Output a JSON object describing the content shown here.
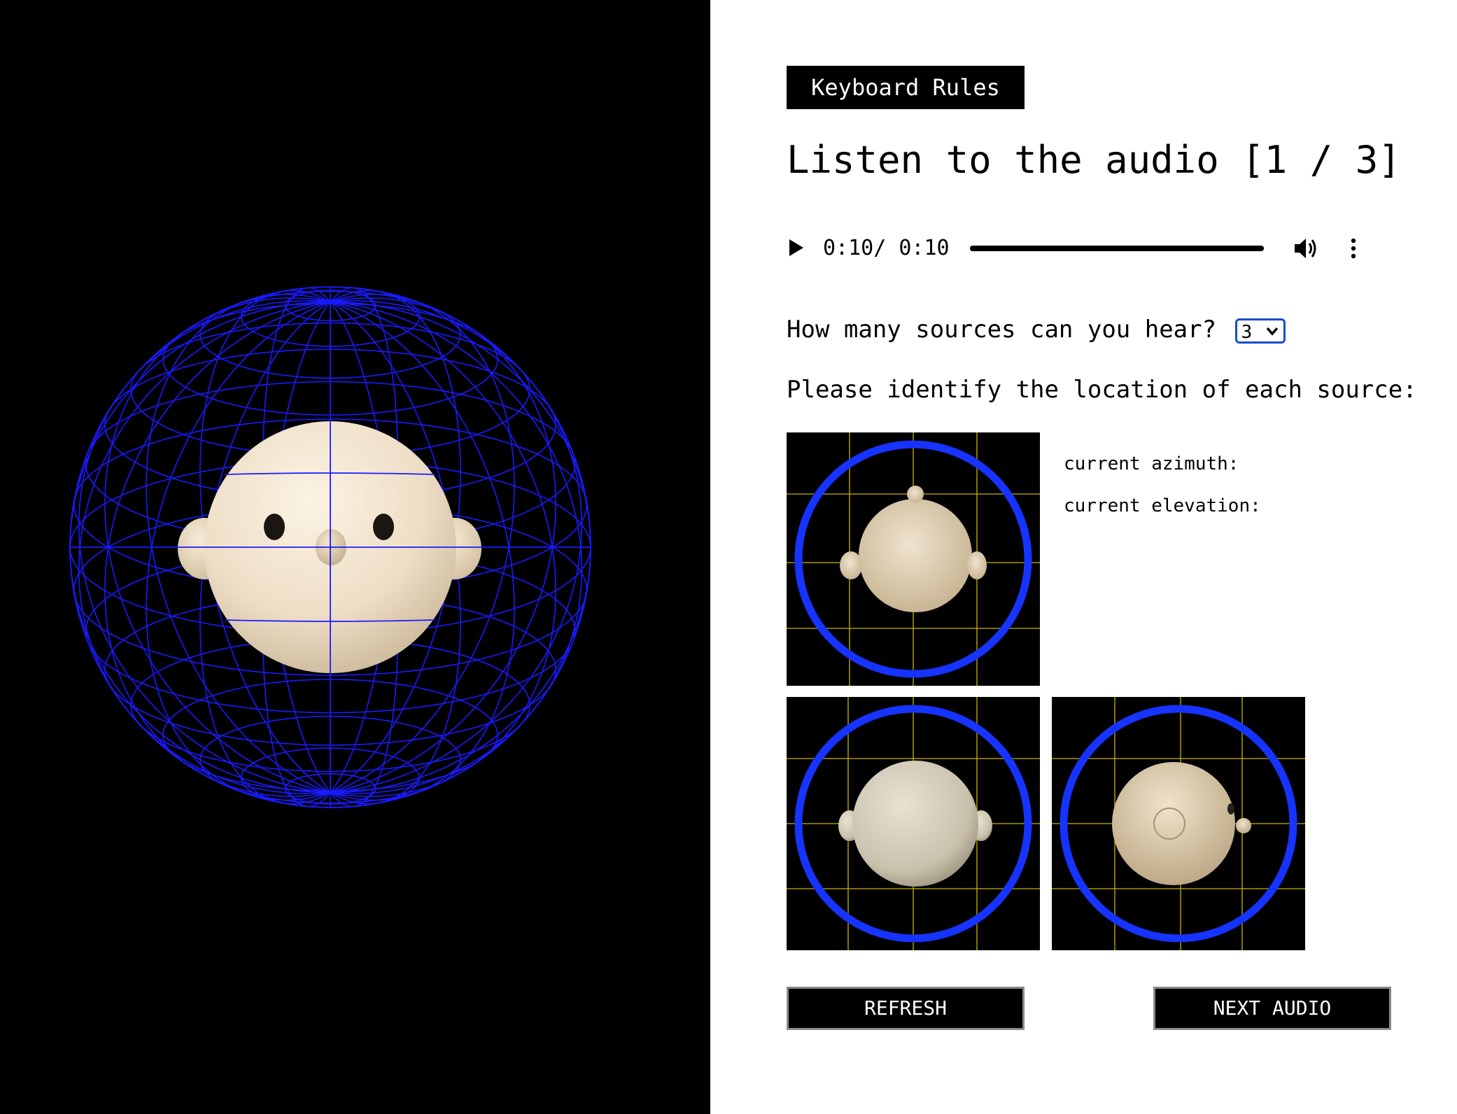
{
  "keyboard_rules_label": "Keyboard Rules",
  "title": "Listen to the audio [1 / 3]",
  "audio": {
    "current_time": "0:10",
    "separator": "/",
    "duration": "0:10",
    "progress": 1.0
  },
  "question": {
    "label": "How many sources can you hear?",
    "selected": "3"
  },
  "identify_label": "Please identify the location of each source:",
  "readouts": {
    "azimuth_label": "current azimuth:",
    "elevation_label": "current elevation:"
  },
  "views": {
    "top": "top-view",
    "front": "front-view",
    "side": "side-view"
  },
  "buttons": {
    "refresh": "REFRESH",
    "next": "NEXT AUDIO"
  },
  "colors": {
    "wireframe": "#1a1aff",
    "ring": "#1733ff",
    "head": "#f1e3cc",
    "grid_lines": "#c8b400",
    "background_dark": "#000000"
  },
  "icons": {
    "play": "play-icon",
    "volume": "volume-icon",
    "more": "more-vert-icon",
    "dropdown": "chevron-down-icon"
  }
}
